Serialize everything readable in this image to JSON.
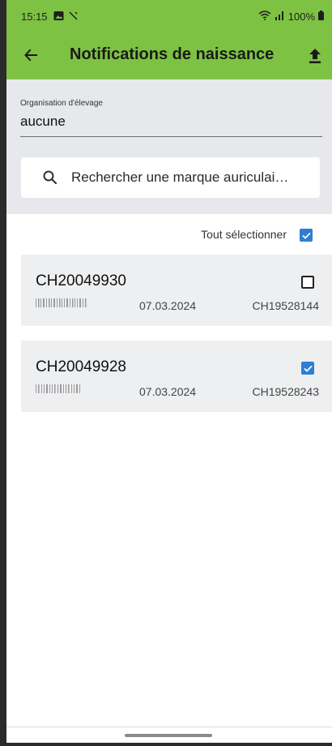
{
  "status_bar": {
    "time": "15:15",
    "battery": "100%"
  },
  "header": {
    "title": "Notifications de naissance"
  },
  "organisation": {
    "label": "Organisation d'élevage",
    "value": "aucune"
  },
  "search": {
    "placeholder": "Rechercher une marque auriculai…"
  },
  "select_all": {
    "label": "Tout sélectionner",
    "checked": true
  },
  "notifications": [
    {
      "ear_tag": "CH20049930",
      "date": "07.03.2024",
      "mother_tag": "CH19528144",
      "checked": false
    },
    {
      "ear_tag": "CH20049928",
      "date": "07.03.2024",
      "mother_tag": "CH19528243",
      "checked": true
    }
  ],
  "colors": {
    "header_green": "#7dc243",
    "filter_grey": "#e6e8eb",
    "card_grey": "#eeeff1",
    "checkbox_blue": "#2e7fd3"
  }
}
